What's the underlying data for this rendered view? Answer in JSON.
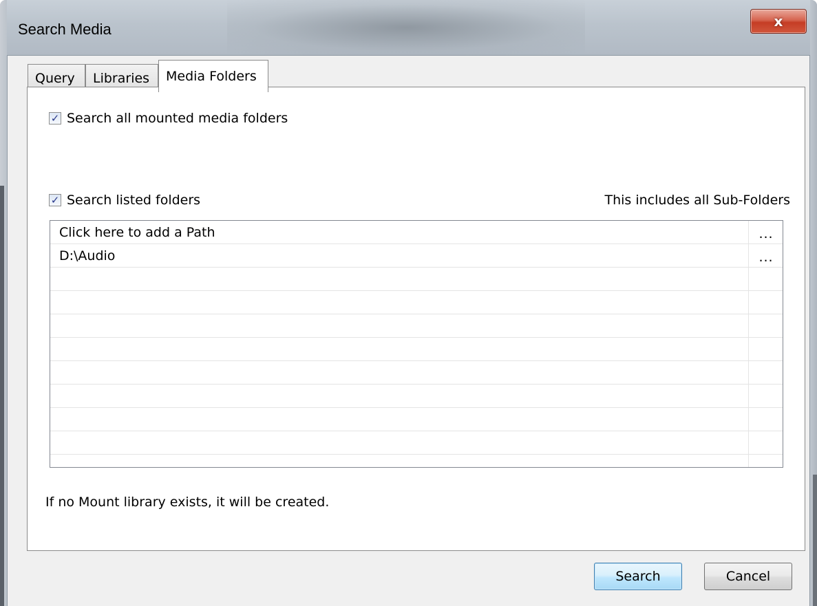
{
  "window": {
    "title": "Search Media",
    "close_glyph": "x"
  },
  "tabs": [
    {
      "label": "Query",
      "active": false
    },
    {
      "label": "Libraries",
      "active": false
    },
    {
      "label": "Media Folders",
      "active": true
    }
  ],
  "media_folders": {
    "search_all_mounted": {
      "label": "Search all mounted media folders",
      "checked": true
    },
    "search_listed": {
      "label": "Search listed folders",
      "checked": true
    },
    "subfolders_hint": "This includes all Sub-Folders",
    "paths": [
      {
        "text": "Click here to add a Path",
        "browse": "..."
      },
      {
        "text": "D:\\Audio",
        "browse": "..."
      }
    ],
    "note": "If no Mount library exists, it will be created."
  },
  "buttons": {
    "search": "Search",
    "cancel": "Cancel"
  },
  "check_glyph": "✓"
}
